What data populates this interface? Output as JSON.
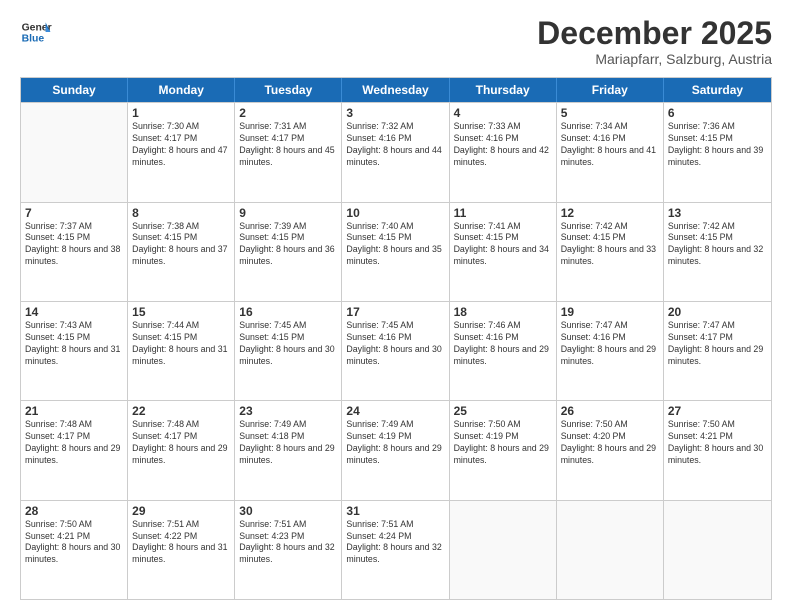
{
  "header": {
    "logo_general": "General",
    "logo_blue": "Blue",
    "month": "December 2025",
    "location": "Mariapfarr, Salzburg, Austria"
  },
  "weekdays": [
    "Sunday",
    "Monday",
    "Tuesday",
    "Wednesday",
    "Thursday",
    "Friday",
    "Saturday"
  ],
  "rows": [
    [
      {
        "day": "",
        "sunrise": "",
        "sunset": "",
        "daylight": ""
      },
      {
        "day": "1",
        "sunrise": "Sunrise: 7:30 AM",
        "sunset": "Sunset: 4:17 PM",
        "daylight": "Daylight: 8 hours and 47 minutes."
      },
      {
        "day": "2",
        "sunrise": "Sunrise: 7:31 AM",
        "sunset": "Sunset: 4:17 PM",
        "daylight": "Daylight: 8 hours and 45 minutes."
      },
      {
        "day": "3",
        "sunrise": "Sunrise: 7:32 AM",
        "sunset": "Sunset: 4:16 PM",
        "daylight": "Daylight: 8 hours and 44 minutes."
      },
      {
        "day": "4",
        "sunrise": "Sunrise: 7:33 AM",
        "sunset": "Sunset: 4:16 PM",
        "daylight": "Daylight: 8 hours and 42 minutes."
      },
      {
        "day": "5",
        "sunrise": "Sunrise: 7:34 AM",
        "sunset": "Sunset: 4:16 PM",
        "daylight": "Daylight: 8 hours and 41 minutes."
      },
      {
        "day": "6",
        "sunrise": "Sunrise: 7:36 AM",
        "sunset": "Sunset: 4:15 PM",
        "daylight": "Daylight: 8 hours and 39 minutes."
      }
    ],
    [
      {
        "day": "7",
        "sunrise": "Sunrise: 7:37 AM",
        "sunset": "Sunset: 4:15 PM",
        "daylight": "Daylight: 8 hours and 38 minutes."
      },
      {
        "day": "8",
        "sunrise": "Sunrise: 7:38 AM",
        "sunset": "Sunset: 4:15 PM",
        "daylight": "Daylight: 8 hours and 37 minutes."
      },
      {
        "day": "9",
        "sunrise": "Sunrise: 7:39 AM",
        "sunset": "Sunset: 4:15 PM",
        "daylight": "Daylight: 8 hours and 36 minutes."
      },
      {
        "day": "10",
        "sunrise": "Sunrise: 7:40 AM",
        "sunset": "Sunset: 4:15 PM",
        "daylight": "Daylight: 8 hours and 35 minutes."
      },
      {
        "day": "11",
        "sunrise": "Sunrise: 7:41 AM",
        "sunset": "Sunset: 4:15 PM",
        "daylight": "Daylight: 8 hours and 34 minutes."
      },
      {
        "day": "12",
        "sunrise": "Sunrise: 7:42 AM",
        "sunset": "Sunset: 4:15 PM",
        "daylight": "Daylight: 8 hours and 33 minutes."
      },
      {
        "day": "13",
        "sunrise": "Sunrise: 7:42 AM",
        "sunset": "Sunset: 4:15 PM",
        "daylight": "Daylight: 8 hours and 32 minutes."
      }
    ],
    [
      {
        "day": "14",
        "sunrise": "Sunrise: 7:43 AM",
        "sunset": "Sunset: 4:15 PM",
        "daylight": "Daylight: 8 hours and 31 minutes."
      },
      {
        "day": "15",
        "sunrise": "Sunrise: 7:44 AM",
        "sunset": "Sunset: 4:15 PM",
        "daylight": "Daylight: 8 hours and 31 minutes."
      },
      {
        "day": "16",
        "sunrise": "Sunrise: 7:45 AM",
        "sunset": "Sunset: 4:15 PM",
        "daylight": "Daylight: 8 hours and 30 minutes."
      },
      {
        "day": "17",
        "sunrise": "Sunrise: 7:45 AM",
        "sunset": "Sunset: 4:16 PM",
        "daylight": "Daylight: 8 hours and 30 minutes."
      },
      {
        "day": "18",
        "sunrise": "Sunrise: 7:46 AM",
        "sunset": "Sunset: 4:16 PM",
        "daylight": "Daylight: 8 hours and 29 minutes."
      },
      {
        "day": "19",
        "sunrise": "Sunrise: 7:47 AM",
        "sunset": "Sunset: 4:16 PM",
        "daylight": "Daylight: 8 hours and 29 minutes."
      },
      {
        "day": "20",
        "sunrise": "Sunrise: 7:47 AM",
        "sunset": "Sunset: 4:17 PM",
        "daylight": "Daylight: 8 hours and 29 minutes."
      }
    ],
    [
      {
        "day": "21",
        "sunrise": "Sunrise: 7:48 AM",
        "sunset": "Sunset: 4:17 PM",
        "daylight": "Daylight: 8 hours and 29 minutes."
      },
      {
        "day": "22",
        "sunrise": "Sunrise: 7:48 AM",
        "sunset": "Sunset: 4:17 PM",
        "daylight": "Daylight: 8 hours and 29 minutes."
      },
      {
        "day": "23",
        "sunrise": "Sunrise: 7:49 AM",
        "sunset": "Sunset: 4:18 PM",
        "daylight": "Daylight: 8 hours and 29 minutes."
      },
      {
        "day": "24",
        "sunrise": "Sunrise: 7:49 AM",
        "sunset": "Sunset: 4:19 PM",
        "daylight": "Daylight: 8 hours and 29 minutes."
      },
      {
        "day": "25",
        "sunrise": "Sunrise: 7:50 AM",
        "sunset": "Sunset: 4:19 PM",
        "daylight": "Daylight: 8 hours and 29 minutes."
      },
      {
        "day": "26",
        "sunrise": "Sunrise: 7:50 AM",
        "sunset": "Sunset: 4:20 PM",
        "daylight": "Daylight: 8 hours and 29 minutes."
      },
      {
        "day": "27",
        "sunrise": "Sunrise: 7:50 AM",
        "sunset": "Sunset: 4:21 PM",
        "daylight": "Daylight: 8 hours and 30 minutes."
      }
    ],
    [
      {
        "day": "28",
        "sunrise": "Sunrise: 7:50 AM",
        "sunset": "Sunset: 4:21 PM",
        "daylight": "Daylight: 8 hours and 30 minutes."
      },
      {
        "day": "29",
        "sunrise": "Sunrise: 7:51 AM",
        "sunset": "Sunset: 4:22 PM",
        "daylight": "Daylight: 8 hours and 31 minutes."
      },
      {
        "day": "30",
        "sunrise": "Sunrise: 7:51 AM",
        "sunset": "Sunset: 4:23 PM",
        "daylight": "Daylight: 8 hours and 32 minutes."
      },
      {
        "day": "31",
        "sunrise": "Sunrise: 7:51 AM",
        "sunset": "Sunset: 4:24 PM",
        "daylight": "Daylight: 8 hours and 32 minutes."
      },
      {
        "day": "",
        "sunrise": "",
        "sunset": "",
        "daylight": ""
      },
      {
        "day": "",
        "sunrise": "",
        "sunset": "",
        "daylight": ""
      },
      {
        "day": "",
        "sunrise": "",
        "sunset": "",
        "daylight": ""
      }
    ]
  ]
}
